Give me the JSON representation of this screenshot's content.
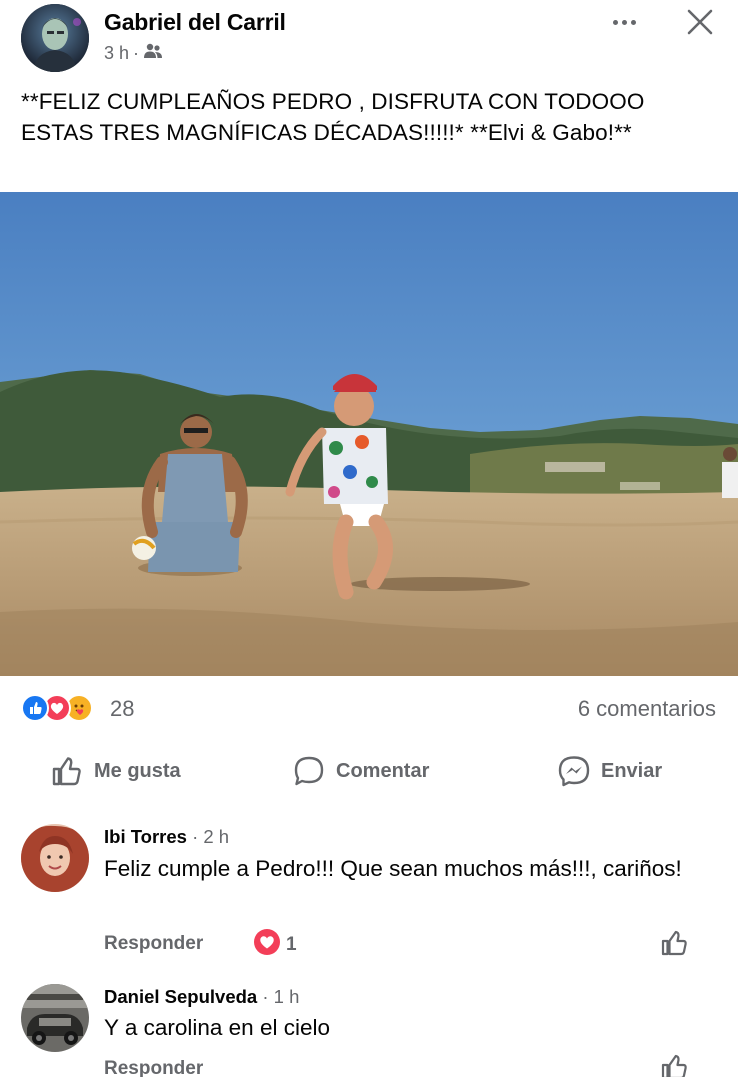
{
  "post": {
    "author": "Gabriel del Carril",
    "time": "3 h",
    "separator": "·",
    "audience_icon": "friends-icon",
    "text": "**FELIZ  CUMPLEAÑOS PEDRO ,  DISFRUTA CON TODOOO ESTAS TRES MAGNÍFICAS  DÉCADAS!!!!!* **Elvi &  Gabo!**"
  },
  "reactions": {
    "icons": [
      "like-reaction-icon",
      "love-reaction-icon",
      "care-reaction-icon"
    ],
    "count": "28",
    "comments_count": "6 comentarios"
  },
  "actions": {
    "like": "Me gusta",
    "comment": "Comentar",
    "send": "Enviar"
  },
  "comments": [
    {
      "author": "Ibi Torres",
      "time": "· 2 h",
      "text": "Feliz cumple a Pedro!!! Que sean muchos más!!!, cariños!",
      "reply": "Responder",
      "reaction_count": "1"
    },
    {
      "author": "Daniel Sepulveda",
      "time": "· 1 h",
      "text": "Y a carolina en el cielo",
      "reply": "Responder"
    }
  ],
  "colors": {
    "text_primary": "#050505",
    "text_secondary": "#65676b",
    "like_blue": "#1877f2",
    "love_red": "#f33e58",
    "care_yellow": "#f7b125"
  }
}
